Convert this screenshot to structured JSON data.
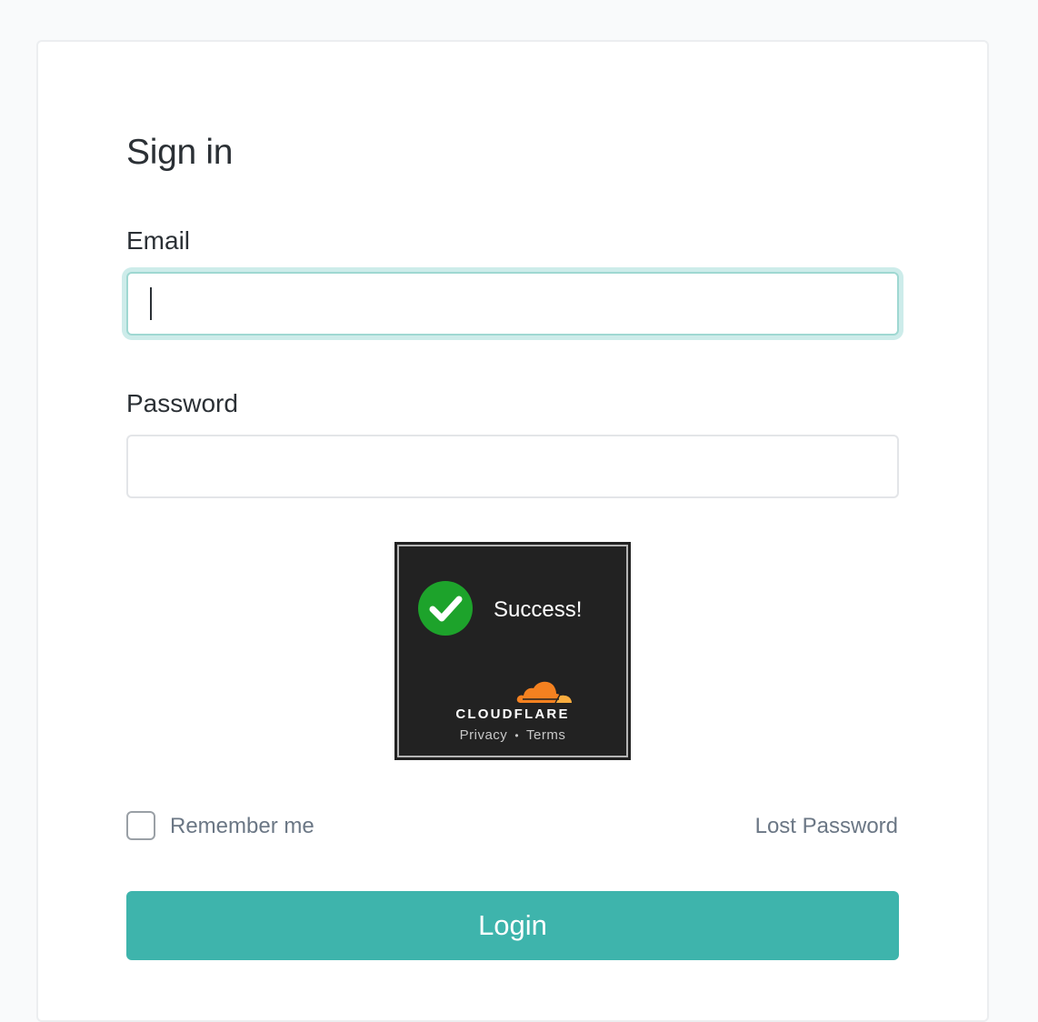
{
  "form": {
    "title": "Sign in",
    "email_label": "Email",
    "email_value": "",
    "password_label": "Password",
    "password_value": "",
    "remember_label": "Remember me",
    "remember_checked": false,
    "lost_password_label": "Lost Password",
    "login_label": "Login"
  },
  "captcha": {
    "status_text": "Success!",
    "brand": "CLOUDFLARE",
    "privacy_label": "Privacy",
    "separator": "•",
    "terms_label": "Terms",
    "icons": [
      "check-circle-icon",
      "cloudflare-cloud-icon"
    ]
  },
  "colors": {
    "accent": "#3eb4ac",
    "focus_ring": "#cdecea",
    "success_green": "#1da32b",
    "cloudflare_orange": "#f48120",
    "widget_bg": "#222222"
  }
}
